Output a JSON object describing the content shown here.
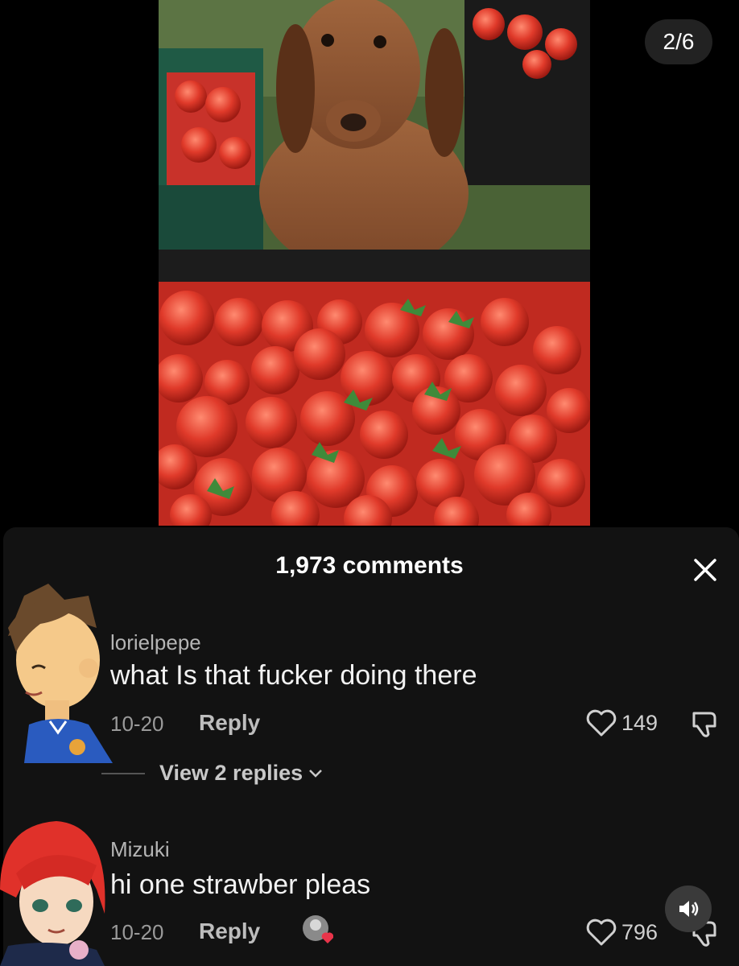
{
  "media": {
    "position": "2/6"
  },
  "comments_sheet": {
    "title": "1,973 comments",
    "close_icon": "close-icon"
  },
  "comments": [
    {
      "username": "lorielpepe",
      "text": "what Is that fucker doing there",
      "date": "10-20",
      "reply_label": "Reply",
      "likes": "149",
      "view_replies": "View 2 replies"
    },
    {
      "username": "Mizuki",
      "text": "hi one strawber pleas",
      "date": "10-20",
      "reply_label": "Reply",
      "likes": "796"
    }
  ],
  "icons": {
    "like": "heart-outline-icon",
    "dislike": "thumbs-down-icon",
    "sound": "speaker-icon",
    "chevron": "chevron-down-icon"
  },
  "colors": {
    "sheet_bg": "#121212",
    "text_primary": "#f2f2f2",
    "text_secondary": "#9a9a9a"
  }
}
